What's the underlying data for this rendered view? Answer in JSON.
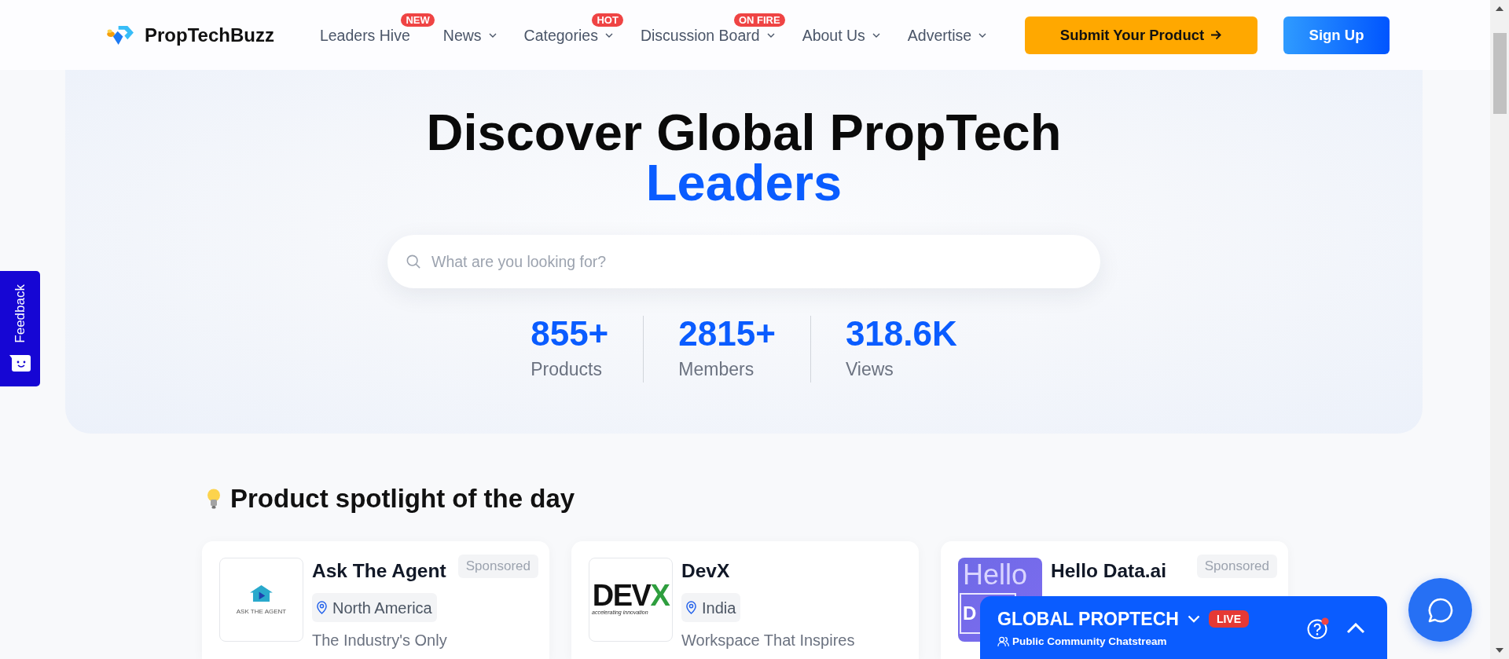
{
  "header": {
    "brand": "PropTechBuzz",
    "nav": [
      {
        "label": "Leaders Hive",
        "badge": "NEW",
        "dropdown": false
      },
      {
        "label": "News",
        "dropdown": true
      },
      {
        "label": "Categories",
        "badge": "HOT",
        "dropdown": true
      },
      {
        "label": "Discussion Board",
        "badge": "ON FIRE",
        "dropdown": true
      },
      {
        "label": "About Us",
        "dropdown": true
      },
      {
        "label": "Advertise",
        "dropdown": true
      }
    ],
    "actions": [
      {
        "label": "Submit Your Product",
        "kind": "submit"
      },
      {
        "label": "Sign Up",
        "kind": "signup"
      }
    ]
  },
  "feedback_tab": {
    "label": "Feedback"
  },
  "hero": {
    "title": "Discover Global PropTech",
    "highlight": "Leaders",
    "search": {
      "placeholder": "What are you looking for?"
    },
    "stats": [
      {
        "value": "855+",
        "label": "Products"
      },
      {
        "value": "2815+",
        "label": "Members"
      },
      {
        "value": "318.6K",
        "label": "Views"
      }
    ]
  },
  "spotlight": {
    "title": "Product spotlight of the day",
    "cards": [
      {
        "name": "Ask The Agent",
        "logo": {
          "kind": "house",
          "text": "ASK THE AGENT"
        },
        "badge": "Sponsored",
        "location": "North America",
        "description": "The Industry's Only"
      },
      {
        "name": "DevX",
        "logo": {
          "kind": "wordmark",
          "text": "DEVX",
          "tagline": "accelerating innovation"
        },
        "location": "India",
        "description": "Workspace That Inspires"
      },
      {
        "name": "Hello Data.ai",
        "logo": {
          "kind": "split",
          "text": "Hello",
          "letter": "D"
        },
        "badge": "Sponsored"
      }
    ]
  },
  "chat_widget": {
    "title": "GLOBAL PROPTECH",
    "badge": "LIVE",
    "subtitle": "Public Community Chatstream",
    "notification": true
  }
}
